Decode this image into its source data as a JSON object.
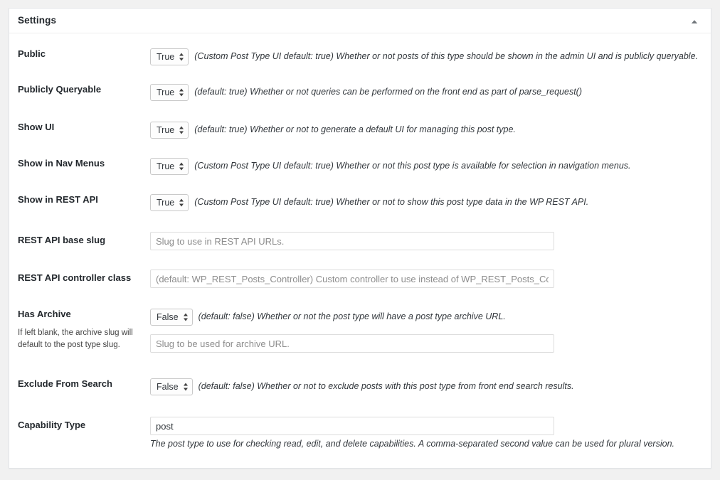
{
  "panel": {
    "title": "Settings",
    "collapse_icon": "caret-up-icon"
  },
  "select_options": [
    "True",
    "False"
  ],
  "fields": [
    {
      "key": "public",
      "label": "Public",
      "control": "select",
      "value": "True",
      "description": "(Custom Post Type UI default: true) Whether or not posts of this type should be shown in the admin UI and is publicly queryable."
    },
    {
      "key": "publicly_queryable",
      "label": "Publicly Queryable",
      "control": "select",
      "value": "True",
      "description": "(default: true) Whether or not queries can be performed on the front end as part of parse_request()"
    },
    {
      "key": "show_ui",
      "label": "Show UI",
      "control": "select",
      "value": "True",
      "description": "(default: true) Whether or not to generate a default UI for managing this post type."
    },
    {
      "key": "show_in_nav_menus",
      "label": "Show in Nav Menus",
      "control": "select",
      "value": "True",
      "description": "(Custom Post Type UI default: true) Whether or not this post type is available for selection in navigation menus."
    },
    {
      "key": "show_in_rest",
      "label": "Show in REST API",
      "control": "select",
      "value": "True",
      "description": "(Custom Post Type UI default: true) Whether or not to show this post type data in the WP REST API."
    },
    {
      "key": "rest_base",
      "label": "REST API base slug",
      "control": "text",
      "value": "",
      "placeholder": "Slug to use in REST API URLs."
    },
    {
      "key": "rest_controller_class",
      "label": "REST API controller class",
      "control": "text",
      "value": "",
      "placeholder": "(default: WP_REST_Posts_Controller) Custom controller to use instead of WP_REST_Posts_Controller."
    },
    {
      "key": "has_archive",
      "label": "Has Archive",
      "sublabel": "If left blank, the archive slug will default to the post type slug.",
      "control": "select_plus_text",
      "value": "False",
      "description": "(default: false) Whether or not the post type will have a post type archive URL.",
      "slug_placeholder": "Slug to be used for archive URL.",
      "slug_value": ""
    },
    {
      "key": "exclude_from_search",
      "label": "Exclude From Search",
      "control": "select",
      "value": "False",
      "description": "(default: false) Whether or not to exclude posts with this post type from front end search results."
    },
    {
      "key": "capability_type",
      "label": "Capability Type",
      "control": "text_with_desc",
      "value": "post",
      "placeholder": "",
      "description": "The post type to use for checking read, edit, and delete capabilities. A comma-separated second value can be used for plural version."
    }
  ]
}
